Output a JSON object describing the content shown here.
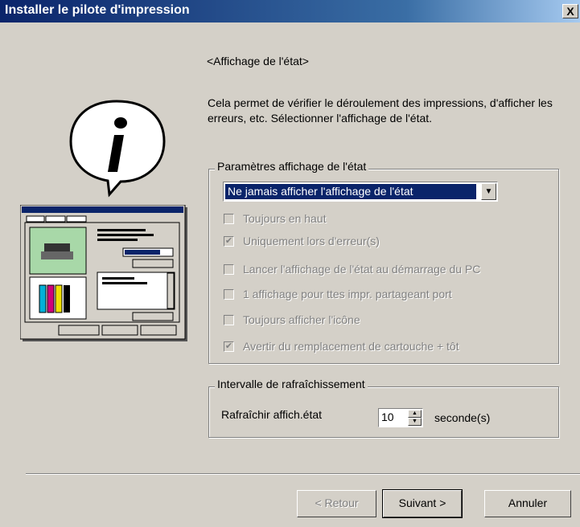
{
  "window": {
    "title": "Installer le pilote d'impression",
    "close_label": "X"
  },
  "main": {
    "heading": "<Affichage de l'état>",
    "description": "Cela permet de vérifier le déroulement des impressions, d'afficher les erreurs, etc. Sélectionner l'affichage de l'état."
  },
  "status_group": {
    "legend": "Paramètres affichage de l'état",
    "select_value": "Ne jamais afficher l'affichage de l'état",
    "checkboxes": [
      {
        "label": "Toujours en haut",
        "checked": false
      },
      {
        "label": "Uniquement lors d'erreur(s)",
        "checked": true
      },
      {
        "label": "Lancer l'affichage de l'état au démarrage du PC",
        "checked": false
      },
      {
        "label": "1 affichage pour ttes impr. partageant port",
        "checked": false
      },
      {
        "label": "Toujours afficher l'icône",
        "checked": false
      },
      {
        "label": "Avertir du remplacement de cartouche + tôt",
        "checked": true
      }
    ]
  },
  "refresh_group": {
    "legend": "Intervalle de rafraîchissement",
    "label": "Rafraîchir affich.état",
    "value": "10",
    "unit": "seconde(s)"
  },
  "buttons": {
    "back": "< Retour",
    "next": "Suivant >",
    "cancel": "Annuler"
  },
  "icons": {
    "info": "info-speech-bubble-icon",
    "illustration": "printer-status-window-illustration"
  }
}
